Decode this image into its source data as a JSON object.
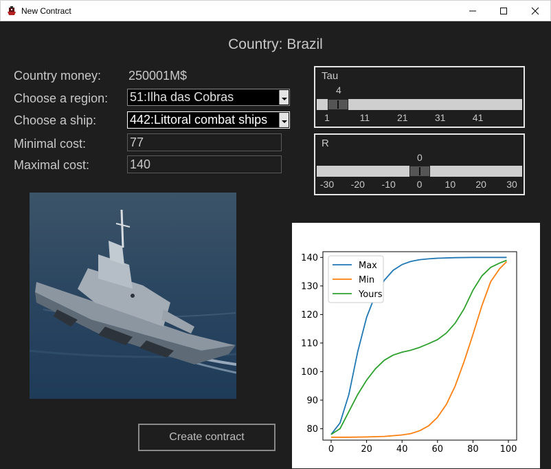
{
  "window": {
    "title": "New Contract",
    "icon": "ship-app-icon",
    "controls": [
      "minimize-icon",
      "maximize-icon",
      "close-icon"
    ]
  },
  "header": {
    "country_title": "Country: Brazil"
  },
  "form": {
    "money_label": "Country money:",
    "money_value": "250001M$",
    "region_label": "Choose a region:",
    "region_value": "51:Ilha das Cobras",
    "ship_label": "Choose a ship:",
    "ship_value": "442:Littoral combat ships",
    "min_cost_label": "Minimal cost:",
    "min_cost_value": "77",
    "max_cost_label": "Maximal cost:",
    "max_cost_value": "140"
  },
  "sliders": {
    "tau": {
      "label": "Tau",
      "value": "4",
      "min": 1,
      "max": 50,
      "ticks": [
        "1",
        "11",
        "21",
        "31",
        "41"
      ]
    },
    "r": {
      "label": "R",
      "value": "0",
      "min": -30,
      "max": 30,
      "ticks": [
        "-30",
        "-20",
        "-10",
        "0",
        "10",
        "20",
        "30"
      ]
    }
  },
  "actions": {
    "create_label": "Create contract"
  },
  "chart_data": {
    "type": "line",
    "title": "",
    "xlabel": "",
    "ylabel": "",
    "xlim": [
      0,
      100
    ],
    "ylim": [
      76,
      142
    ],
    "xticks": [
      "0",
      "20",
      "40",
      "60",
      "80",
      "100"
    ],
    "yticks": [
      "80",
      "90",
      "100",
      "110",
      "120",
      "130",
      "140"
    ],
    "grid": false,
    "legend": "top-left",
    "colors": {
      "Max": "#1f77b4",
      "Min": "#ff7f0e",
      "Yours": "#2ca02c"
    },
    "series": [
      {
        "name": "Max",
        "x": [
          0,
          5,
          10,
          15,
          20,
          25,
          30,
          35,
          40,
          45,
          50,
          55,
          60,
          70,
          80,
          90,
          99
        ],
        "values": [
          78,
          82,
          92,
          107,
          119,
          127,
          132,
          135.5,
          137.5,
          138.6,
          139.2,
          139.5,
          139.7,
          139.9,
          140,
          140,
          140
        ]
      },
      {
        "name": "Min",
        "x": [
          0,
          10,
          20,
          30,
          40,
          45,
          50,
          55,
          60,
          65,
          70,
          75,
          80,
          85,
          90,
          95,
          99
        ],
        "values": [
          77,
          77,
          77.1,
          77.3,
          77.8,
          78.3,
          79.3,
          81,
          84,
          88.5,
          95,
          103.5,
          113,
          123,
          131.5,
          136,
          138.5
        ]
      },
      {
        "name": "Yours",
        "x": [
          0,
          5,
          10,
          15,
          20,
          25,
          30,
          35,
          40,
          45,
          50,
          55,
          60,
          65,
          70,
          75,
          80,
          85,
          90,
          95,
          99
        ],
        "values": [
          78,
          80,
          86,
          92,
          97,
          101,
          104,
          105.8,
          106.8,
          107.5,
          108.5,
          109.8,
          111.2,
          113.5,
          117,
          122,
          128.5,
          133.5,
          136.5,
          138,
          139
        ]
      }
    ]
  }
}
